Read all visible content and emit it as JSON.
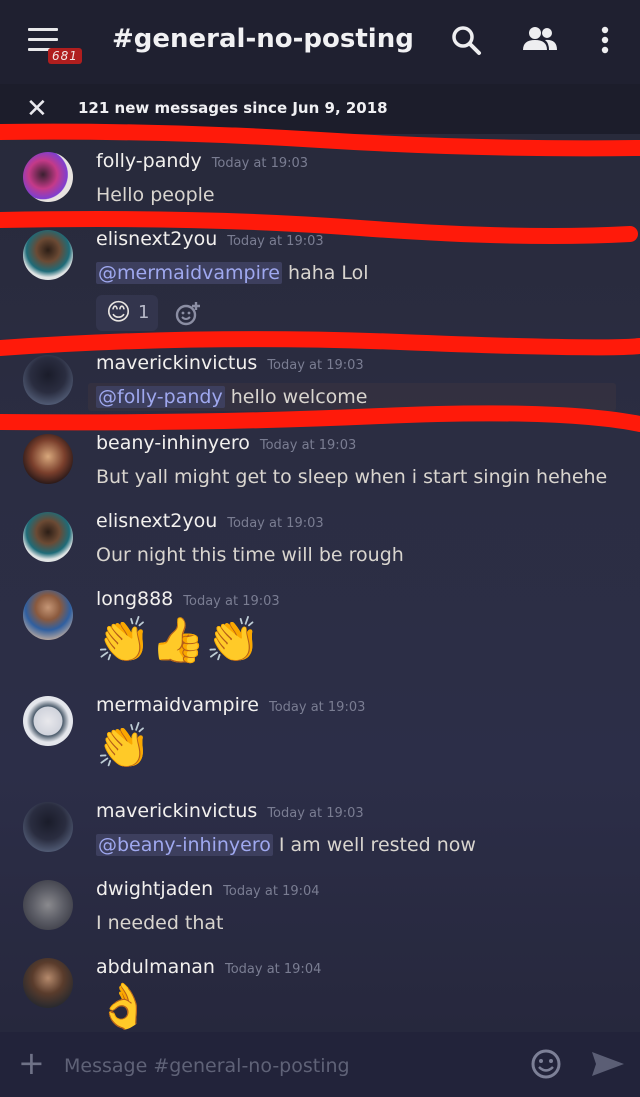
{
  "header": {
    "title": "#general-no-posting",
    "badge": "681"
  },
  "banner": {
    "text": "121 new messages since Jun 9, 2018"
  },
  "messages": [
    {
      "author": "folly-pandy",
      "time": "Today at 19:03",
      "text": "Hello people"
    },
    {
      "author": "elisnext2you",
      "time": "Today at 19:03",
      "mention": "@mermaidvampire",
      "text": " haha Lol",
      "reaction_count": "1"
    },
    {
      "author": "maverickinvictus",
      "time": "Today at 19:03",
      "mention": "@folly-pandy",
      "text": " hello welcome"
    },
    {
      "author": "beany-inhinyero",
      "time": "Today at 19:03",
      "text": "But yall might get to sleep when i start singin hehehe"
    },
    {
      "author": "elisnext2you",
      "time": "Today at 19:03",
      "text": "Our night this time will be rough"
    },
    {
      "author": "long888",
      "time": "Today at 19:03",
      "emoji": "👏👍👏"
    },
    {
      "author": "mermaidvampire",
      "time": "Today at 19:03",
      "emoji": "👏"
    },
    {
      "author": "maverickinvictus",
      "time": "Today at 19:03",
      "mention": "@beany-inhinyero",
      "text": " I am well rested now"
    },
    {
      "author": "dwightjaden",
      "time": "Today at 19:04",
      "text": "I needed that"
    },
    {
      "author": "abdulmanan",
      "time": "Today at 19:04",
      "emoji": "👌"
    }
  ],
  "composer": {
    "placeholder": "Message #general-no-posting"
  },
  "colors": {
    "annotation": "#ff1a0a",
    "mention": "#9fa8ef",
    "timestamp": "#7a7d92"
  },
  "icons": [
    "menu-icon",
    "search-icon",
    "members-icon",
    "more-icon",
    "close-icon",
    "add-reaction-icon",
    "plus-icon",
    "emoji-icon",
    "send-icon"
  ]
}
